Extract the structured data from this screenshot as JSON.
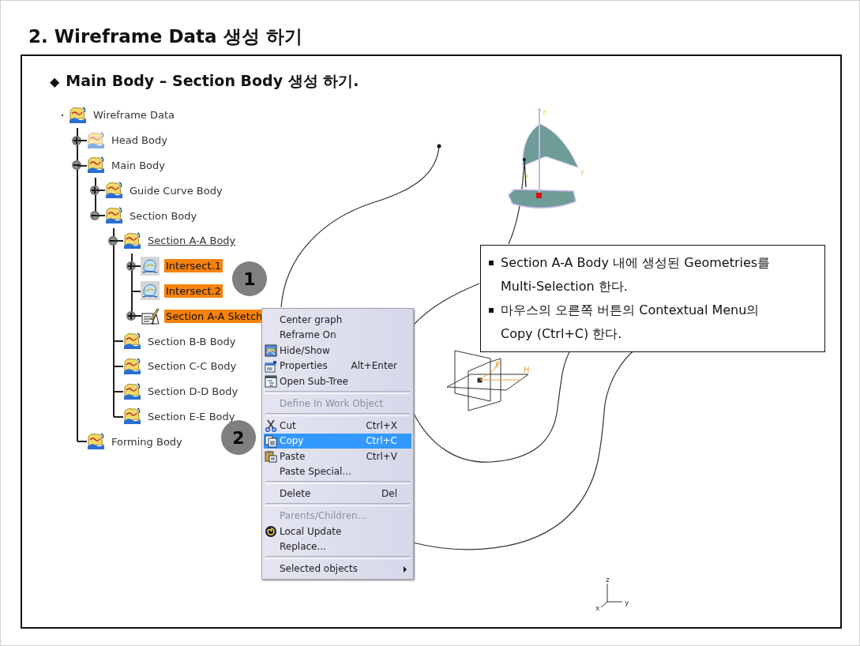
{
  "slide": {
    "title": "2. Wireframe Data 생성 하기",
    "heading": {
      "marker": "◆",
      "text": "Main Body – Section Body 생성 하기."
    }
  },
  "tree": [
    {
      "label": "Wireframe Data",
      "kind": "body",
      "expandable": false,
      "selected": false,
      "current": false,
      "children": [
        {
          "label": "Head Body",
          "kind": "body-hidden",
          "expandable": true,
          "expanded": false,
          "selected": false,
          "current": false
        },
        {
          "label": "Main Body",
          "kind": "body",
          "expandable": true,
          "expanded": true,
          "selected": false,
          "current": false,
          "children": [
            {
              "label": "Guide Curve Body",
              "kind": "body",
              "expandable": true,
              "expanded": false,
              "selected": false,
              "current": false
            },
            {
              "label": "Section Body",
              "kind": "body",
              "expandable": true,
              "expanded": true,
              "selected": false,
              "current": false,
              "children": [
                {
                  "label": "Section A-A Body",
                  "kind": "body",
                  "expandable": true,
                  "expanded": true,
                  "selected": false,
                  "current": true,
                  "children": [
                    {
                      "label": "Intersect.1",
                      "kind": "intersect",
                      "expandable": true,
                      "expanded": false,
                      "selected": true,
                      "current": false
                    },
                    {
                      "label": "Intersect.2",
                      "kind": "intersect",
                      "expandable": false,
                      "selected": true,
                      "current": false
                    },
                    {
                      "label": "Section A-A Sketch",
                      "kind": "sketch",
                      "expandable": true,
                      "expanded": false,
                      "selected": true,
                      "current": false
                    }
                  ]
                },
                {
                  "label": "Section B-B Body",
                  "kind": "body",
                  "expandable": false,
                  "selected": false,
                  "current": false
                },
                {
                  "label": "Section C-C Body",
                  "kind": "body",
                  "expandable": false,
                  "selected": false,
                  "current": false
                },
                {
                  "label": "Section D-D Body",
                  "kind": "body",
                  "expandable": false,
                  "selected": false,
                  "current": false
                },
                {
                  "label": "Section E-E Body",
                  "kind": "body",
                  "expandable": false,
                  "selected": false,
                  "current": false
                }
              ]
            }
          ]
        },
        {
          "label": "Forming Body",
          "kind": "body",
          "expandable": false,
          "selected": false,
          "current": false
        }
      ]
    }
  ],
  "context_menu": [
    {
      "kind": "item",
      "label": "Center graph",
      "disabled": false,
      "selected": false
    },
    {
      "kind": "item",
      "label": "Reframe On",
      "disabled": false,
      "selected": false
    },
    {
      "kind": "item",
      "label": "Hide/Show",
      "disabled": false,
      "selected": false
    },
    {
      "kind": "item",
      "label": "Properties",
      "shortcut": "Alt+Enter",
      "disabled": false,
      "selected": false
    },
    {
      "kind": "item",
      "label": "Open Sub-Tree",
      "disabled": false,
      "selected": false
    },
    {
      "kind": "separator"
    },
    {
      "kind": "item",
      "label": "Define In Work Object",
      "disabled": true,
      "selected": false
    },
    {
      "kind": "separator"
    },
    {
      "kind": "item",
      "label": "Cut",
      "shortcut": "Ctrl+X",
      "disabled": false,
      "selected": false
    },
    {
      "kind": "item",
      "label": "Copy",
      "shortcut": "Ctrl+C",
      "disabled": false,
      "selected": true
    },
    {
      "kind": "item",
      "label": "Paste",
      "shortcut": "Ctrl+V",
      "disabled": false,
      "selected": false
    },
    {
      "kind": "item",
      "label": "Paste Special...",
      "disabled": false,
      "selected": false
    },
    {
      "kind": "separator"
    },
    {
      "kind": "item",
      "label": "Delete",
      "shortcut": "Del",
      "disabled": false,
      "selected": false
    },
    {
      "kind": "separator"
    },
    {
      "kind": "item",
      "label": "Parents/Children...",
      "disabled": true,
      "selected": false
    },
    {
      "kind": "item",
      "label": "Local Update",
      "disabled": false,
      "selected": false
    },
    {
      "kind": "item",
      "label": "Replace...",
      "disabled": false,
      "selected": false
    },
    {
      "kind": "separator"
    },
    {
      "kind": "item",
      "label": "Selected objects",
      "disabled": false,
      "selected": false,
      "submenu": true
    }
  ],
  "callout": [
    "Section A-A Body 내에 생성된 Geometries를 Multi-Selection 한다.",
    "마우스의 오른쪽 버튼의 Contextual Menu의 Copy (Ctrl+C) 한다."
  ],
  "step_badges": [
    "1",
    "2"
  ],
  "viewport": {
    "surface_axis_labels": [
      "z",
      "x",
      "y"
    ],
    "axis_labels": [
      "y",
      "H"
    ],
    "compass_labels": [
      "z",
      "y",
      "x"
    ]
  }
}
